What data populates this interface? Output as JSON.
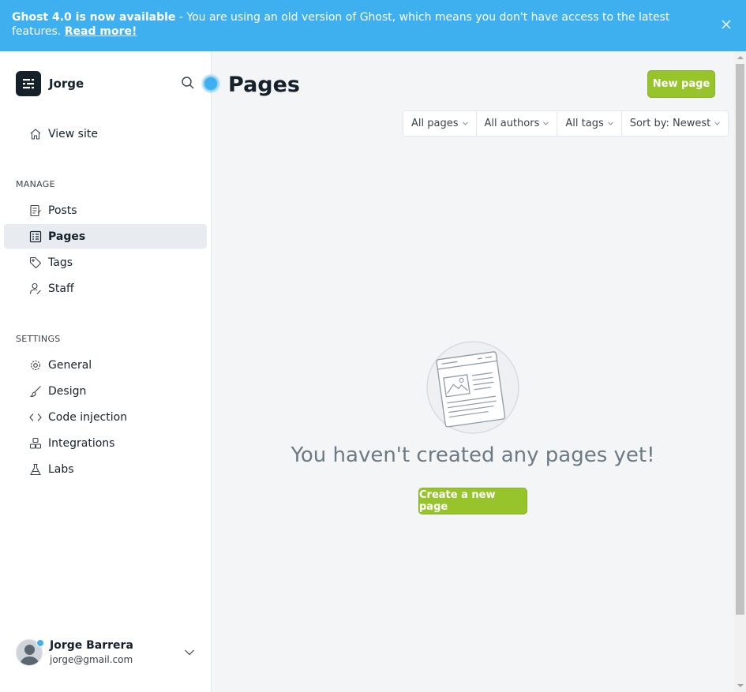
{
  "banner": {
    "title": "Ghost 4.0 is now available",
    "message": " - You are using an old version of Ghost, which means you don't have access to the latest features. ",
    "link_label": "Read more!"
  },
  "brand": {
    "name": "Jorge"
  },
  "nav": {
    "view_site": "View site",
    "manage_title": "MANAGE",
    "manage_items": [
      "Posts",
      "Pages",
      "Tags",
      "Staff"
    ],
    "settings_title": "SETTINGS",
    "settings_items": [
      "General",
      "Design",
      "Code injection",
      "Integrations",
      "Labs"
    ],
    "active": "Pages"
  },
  "user": {
    "name": "Jorge Barrera",
    "email": "jorge@gmail.com"
  },
  "main": {
    "title": "Pages",
    "new_button": "New page",
    "filters": [
      "All pages",
      "All authors",
      "All tags",
      "Sort by: Newest"
    ],
    "empty_message": "You haven't created any pages yet!",
    "create_button": "Create a new page"
  },
  "colors": {
    "accent_blue": "#3eb0ef",
    "primary_green": "#97c42b",
    "text": "#15212a"
  },
  "icons": [
    "close-icon",
    "search-icon",
    "home-icon",
    "posts-icon",
    "pages-icon",
    "tag-icon",
    "staff-icon",
    "gear-icon",
    "brush-icon",
    "code-icon",
    "integrations-icon",
    "labs-icon",
    "chevron-down-icon"
  ]
}
